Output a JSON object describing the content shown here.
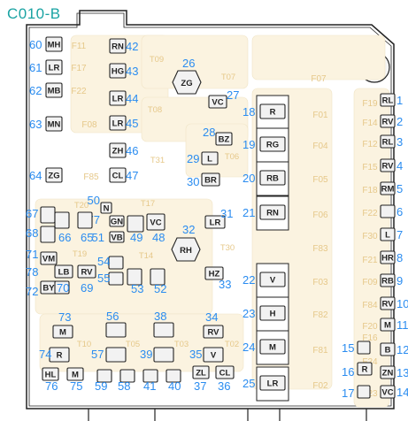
{
  "title": "C010-B",
  "colors": {
    "title": "#1aa3a3",
    "number": "#2a8cf0",
    "label": "#e6c88a",
    "outline": "#222222",
    "zone": "#fbf3e0"
  },
  "relays": [
    {
      "id": "T09",
      "label": "T09"
    },
    {
      "id": "T07",
      "label": "T07"
    },
    {
      "id": "T08",
      "label": "T08"
    },
    {
      "id": "T31",
      "label": "T31"
    },
    {
      "id": "T06",
      "label": "T06"
    },
    {
      "id": "T20",
      "label": "T20"
    },
    {
      "id": "T17",
      "label": "T17"
    },
    {
      "id": "T30",
      "label": "T30"
    },
    {
      "id": "T19",
      "label": "T19"
    },
    {
      "id": "T14",
      "label": "T14"
    },
    {
      "id": "T10",
      "label": "T10"
    },
    {
      "id": "T05",
      "label": "T05"
    },
    {
      "id": "T03",
      "label": "T03"
    },
    {
      "id": "T02",
      "label": "T02"
    }
  ],
  "fuses": [
    {
      "id": "F11",
      "label": "F11"
    },
    {
      "id": "F17",
      "label": "F17"
    },
    {
      "id": "F22",
      "label": "F22"
    },
    {
      "id": "F08",
      "label": "F08"
    },
    {
      "id": "F85",
      "label": "F85"
    },
    {
      "id": "F07",
      "label": "F07"
    },
    {
      "id": "F01",
      "label": "F01"
    },
    {
      "id": "F04",
      "label": "F04"
    },
    {
      "id": "F05",
      "label": "F05"
    },
    {
      "id": "F06",
      "label": "F06"
    },
    {
      "id": "F83",
      "label": "F83"
    },
    {
      "id": "F03",
      "label": "F03"
    },
    {
      "id": "F82",
      "label": "F82"
    },
    {
      "id": "F81",
      "label": "F81"
    },
    {
      "id": "F02",
      "label": "F02"
    },
    {
      "id": "F19",
      "label": "F19"
    },
    {
      "id": "F14",
      "label": "F14"
    },
    {
      "id": "F12",
      "label": "F12"
    },
    {
      "id": "F15",
      "label": "F15"
    },
    {
      "id": "F18",
      "label": "F18"
    },
    {
      "id": "F22b",
      "label": "F22"
    },
    {
      "id": "F30",
      "label": "F30"
    },
    {
      "id": "F21",
      "label": "F21"
    },
    {
      "id": "F09",
      "label": "F09"
    },
    {
      "id": "F84",
      "label": "F84"
    },
    {
      "id": "F20",
      "label": "F20"
    },
    {
      "id": "F16",
      "label": "F16"
    },
    {
      "id": "F24",
      "label": "F24"
    },
    {
      "id": "F23",
      "label": "F23"
    }
  ],
  "connectors": [
    {
      "num": "60",
      "code": "MH"
    },
    {
      "num": "61",
      "code": "LR"
    },
    {
      "num": "62",
      "code": "MB"
    },
    {
      "num": "63",
      "code": "MN"
    },
    {
      "num": "64",
      "code": "ZG"
    },
    {
      "num": "42",
      "code": "RN"
    },
    {
      "num": "43",
      "code": "HG"
    },
    {
      "num": "44",
      "code": "LR"
    },
    {
      "num": "45",
      "code": "LR"
    },
    {
      "num": "46",
      "code": "ZH"
    },
    {
      "num": "47",
      "code": "CL"
    },
    {
      "num": "26",
      "code": "ZG"
    },
    {
      "num": "27",
      "code": "VC"
    },
    {
      "num": "28",
      "code": "BZ"
    },
    {
      "num": "29",
      "code": "L"
    },
    {
      "num": "30",
      "code": "BR"
    },
    {
      "num": "18",
      "code": "R"
    },
    {
      "num": "19",
      "code": "RG"
    },
    {
      "num": "20",
      "code": "RB"
    },
    {
      "num": "21",
      "code": "RN"
    },
    {
      "num": "22",
      "code": "V"
    },
    {
      "num": "23",
      "code": "H"
    },
    {
      "num": "24",
      "code": "M"
    },
    {
      "num": "25",
      "code": "LR"
    },
    {
      "num": "50",
      "code": "N"
    },
    {
      "num": "77",
      "code": "GN"
    },
    {
      "num": "51",
      "code": "VB"
    },
    {
      "num": "49",
      "code": ""
    },
    {
      "num": "48",
      "code": "VC"
    },
    {
      "num": "31",
      "code": "LR"
    },
    {
      "num": "32",
      "code": "RH"
    },
    {
      "num": "33",
      "code": "HZ"
    },
    {
      "num": "67",
      "code": ""
    },
    {
      "num": "68",
      "code": ""
    },
    {
      "num": "66",
      "code": ""
    },
    {
      "num": "65",
      "code": ""
    },
    {
      "num": "71",
      "code": "VM"
    },
    {
      "num": "78",
      "code": "LB"
    },
    {
      "num": "72",
      "code": "BY"
    },
    {
      "num": "70",
      "code": ""
    },
    {
      "num": "69",
      "code": "RV"
    },
    {
      "num": "54",
      "code": ""
    },
    {
      "num": "55",
      "code": ""
    },
    {
      "num": "53",
      "code": ""
    },
    {
      "num": "52",
      "code": ""
    },
    {
      "num": "73",
      "code": "M"
    },
    {
      "num": "56",
      "code": ""
    },
    {
      "num": "38",
      "code": ""
    },
    {
      "num": "34",
      "code": "RV"
    },
    {
      "num": "74",
      "code": "R"
    },
    {
      "num": "57",
      "code": ""
    },
    {
      "num": "39",
      "code": ""
    },
    {
      "num": "35",
      "code": "V"
    },
    {
      "num": "76",
      "code": "HL"
    },
    {
      "num": "75",
      "code": "M"
    },
    {
      "num": "59",
      "code": ""
    },
    {
      "num": "58",
      "code": ""
    },
    {
      "num": "41",
      "code": ""
    },
    {
      "num": "40",
      "code": ""
    },
    {
      "num": "37",
      "code": "ZL"
    },
    {
      "num": "36",
      "code": "CL"
    },
    {
      "num": "1",
      "code": "RL"
    },
    {
      "num": "2",
      "code": "RV"
    },
    {
      "num": "3",
      "code": "RL"
    },
    {
      "num": "4",
      "code": "RV"
    },
    {
      "num": "5",
      "code": "RM"
    },
    {
      "num": "6",
      "code": ""
    },
    {
      "num": "7",
      "code": "L"
    },
    {
      "num": "8",
      "code": "HR"
    },
    {
      "num": "9",
      "code": "RB"
    },
    {
      "num": "10",
      "code": "RV"
    },
    {
      "num": "11",
      "code": "M"
    },
    {
      "num": "12",
      "code": "B"
    },
    {
      "num": "13",
      "code": "ZN"
    },
    {
      "num": "14",
      "code": "VC"
    },
    {
      "num": "15",
      "code": ""
    },
    {
      "num": "16",
      "code": "R"
    },
    {
      "num": "17",
      "code": ""
    }
  ]
}
